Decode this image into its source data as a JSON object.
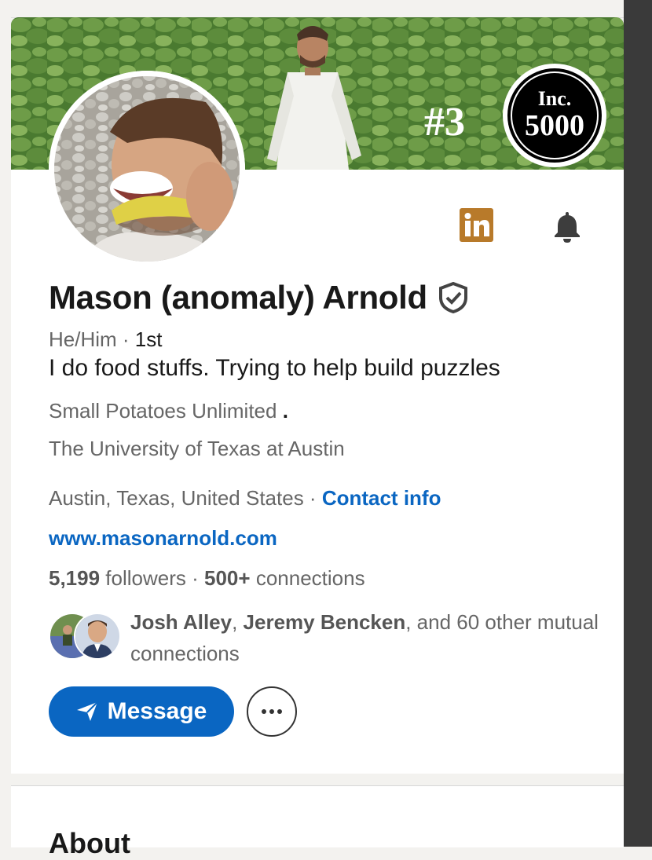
{
  "banner": {
    "rank_text": "#3",
    "badge_line1": "Inc.",
    "badge_line2": "5000"
  },
  "profile": {
    "name": "Mason (anomaly) Arnold",
    "pronouns": "He/Him",
    "degree_sep": " · ",
    "degree": "1st",
    "headline": "I do food stuffs. Trying to help build puzzles",
    "company": "Small Potatoes Unlimited",
    "company_dot": ".",
    "school": "The University of Texas at Austin",
    "location": "Austin, Texas, United States",
    "location_sep": " · ",
    "contact_info": "Contact info",
    "website": "www.masonarnold.com",
    "followers_count": "5,199",
    "followers_label": " followers",
    "stats_sep": "  · ",
    "connections_count": "500+",
    "connections_label": " connections"
  },
  "mutual": {
    "name1": "Josh Alley",
    "sep1": ", ",
    "name2": "Jeremy Bencken",
    "rest": ", and 60 other mutual connections"
  },
  "actions": {
    "message_label": "Message"
  },
  "sections": {
    "about_heading": "About"
  },
  "colors": {
    "brand_blue": "#0a66c2",
    "linkedin_badge": "#b87a2a"
  },
  "icons": [
    "linkedin-icon",
    "bell-icon",
    "verified-shield-icon",
    "send-icon",
    "more-icon"
  ]
}
